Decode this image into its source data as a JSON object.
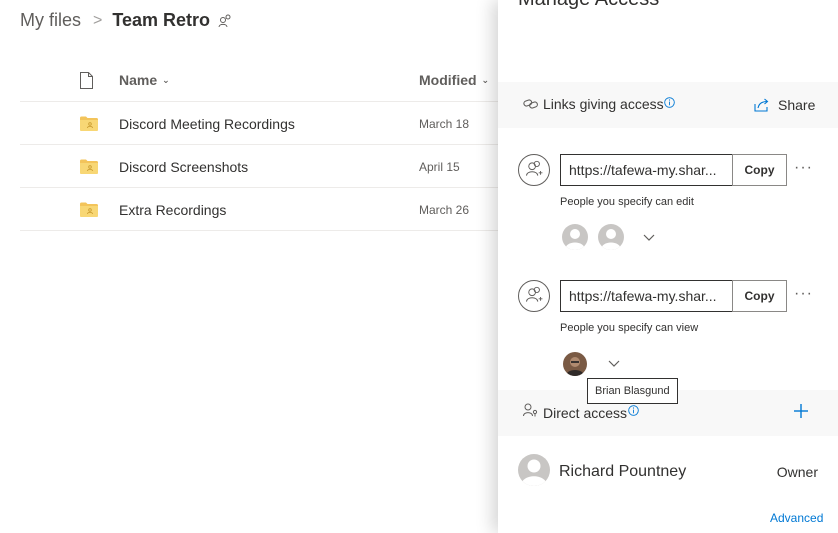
{
  "breadcrumb": {
    "root": "My files",
    "separator": ">",
    "current": "Team Retro"
  },
  "list": {
    "columns": {
      "name": "Name",
      "modified": "Modified"
    },
    "rows": [
      {
        "name": "Discord Meeting Recordings",
        "modified": "March 18",
        "icon": "folder-icon"
      },
      {
        "name": "Discord Screenshots",
        "modified": "April 15",
        "icon": "folder-icon"
      },
      {
        "name": "Extra Recordings",
        "modified": "March 26",
        "icon": "folder-icon"
      }
    ]
  },
  "panel": {
    "title": "Manage Access",
    "links_section": {
      "label": "Links giving access",
      "share_label": "Share"
    },
    "links": [
      {
        "url": "https://tafewa-my.shar...",
        "copy_label": "Copy",
        "permission": "People you specify can edit",
        "more": "···"
      },
      {
        "url": "https://tafewa-my.shar...",
        "copy_label": "Copy",
        "permission": "People you specify can view",
        "more": "···"
      }
    ],
    "tooltip": "Brian Blasgund",
    "direct_section": {
      "label": "Direct access"
    },
    "owner": {
      "name": "Richard Pountney",
      "role": "Owner"
    },
    "advanced_label": "Advanced"
  },
  "colors": {
    "accent": "#0078d4",
    "folder": "#f3c45b",
    "section_bg": "#f8f8f8",
    "text": "#323130"
  }
}
